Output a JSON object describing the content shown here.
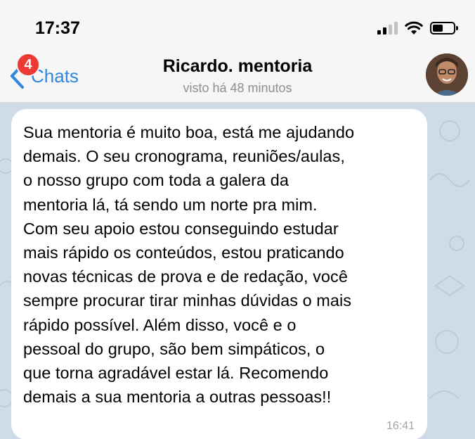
{
  "status_bar": {
    "time": "17:37"
  },
  "header": {
    "back_label": "Chats",
    "unread_badge": "4",
    "title": "Ricardo. mentoria",
    "subtitle": "visto há 48 minutos"
  },
  "message": {
    "lines": [
      "Sua mentoria é muito boa, está me ajudando",
      "demais. O seu cronograma, reuniões/aulas,",
      "o nosso grupo com toda a galera da",
      "mentoria lá, tá sendo um norte pra mim.",
      "Com seu apoio estou conseguindo estudar",
      "mais rápido os conteúdos, estou praticando",
      "novas técnicas de prova e de redação, você",
      "sempre procurar tirar minhas dúvidas o mais",
      "rápido possível. Além disso, você e o",
      "pessoal do grupo, são bem simpáticos, o",
      "que torna agradável estar lá. Recomendo",
      "demais a sua mentoria a outras pessoas!!"
    ],
    "time": "16:41"
  },
  "colors": {
    "accent": "#2f87e0",
    "badge": "#ee3a34",
    "chat_background": "#cfdbe7",
    "bubble": "#ffffff"
  },
  "icons": [
    "cellular-signal-icon",
    "wifi-icon",
    "battery-icon",
    "chevron-left-icon"
  ]
}
